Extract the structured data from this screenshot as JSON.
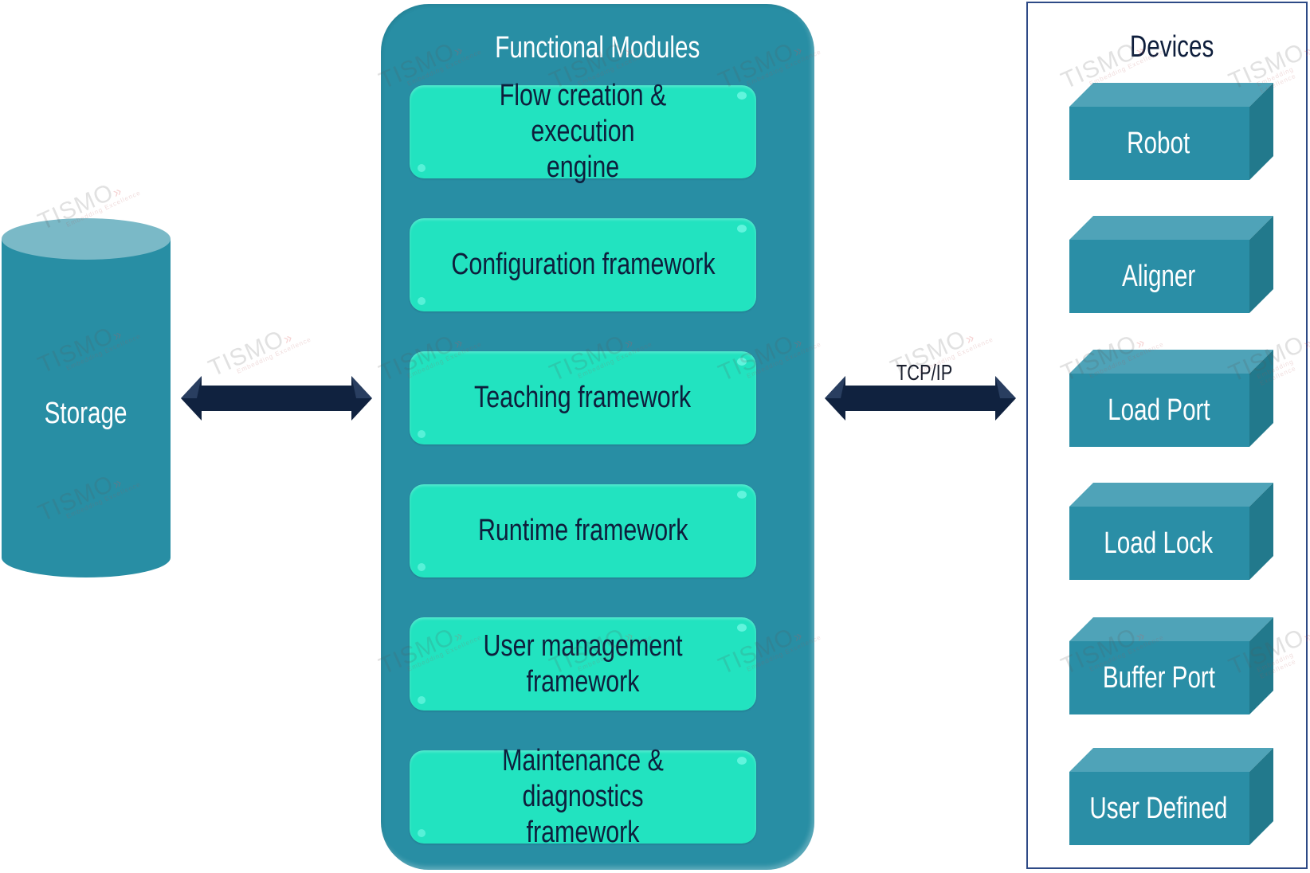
{
  "diagram": {
    "storage": {
      "label": "Storage"
    },
    "storage_link": {
      "label": ""
    },
    "modules_panel": {
      "title": "Functional Modules",
      "modules": [
        {
          "label": "Flow creation & execution\nengine"
        },
        {
          "label": "Configuration framework"
        },
        {
          "label": "Teaching framework"
        },
        {
          "label": "Runtime framework"
        },
        {
          "label": "User management framework"
        },
        {
          "label": "Maintenance & diagnostics\nframework"
        }
      ]
    },
    "device_link": {
      "label": "TCP/IP"
    },
    "devices_panel": {
      "title": "Devices",
      "devices": [
        {
          "label": "Robot"
        },
        {
          "label": "Aligner"
        },
        {
          "label": "Load Port"
        },
        {
          "label": "Load Lock"
        },
        {
          "label": "Buffer Port"
        },
        {
          "label": "User Defined"
        }
      ]
    },
    "watermark": {
      "brand": "TISMO",
      "tagline": "Embedding Excellence"
    },
    "colors": {
      "panel": "#288ea4",
      "module": "#22e3c0",
      "module_text": "#0e1e3c",
      "device_front": "#2a8ea6",
      "device_top": "#4fa3b8",
      "device_side": "#22798c",
      "storage_body": "#288ea4",
      "storage_top": "#7ab9c7",
      "arrow": "#10223f",
      "devices_border": "#2e4a86"
    }
  }
}
